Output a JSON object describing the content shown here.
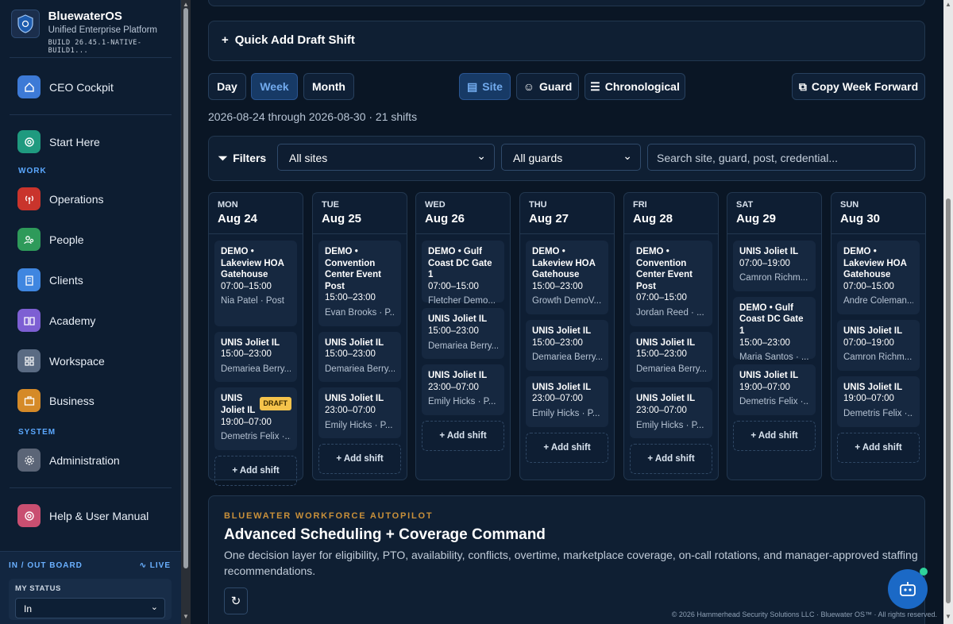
{
  "brand": {
    "title": "BluewaterOS",
    "subtitle": "Unified Enterprise Platform",
    "build": "BUILD 26.45.1-NATIVE-BUILD1..."
  },
  "nav": {
    "ceo": "CEO Cockpit",
    "start": "Start Here",
    "work_header": "WORK",
    "operations": "Operations",
    "people": "People",
    "clients": "Clients",
    "academy": "Academy",
    "workspace": "Workspace",
    "business": "Business",
    "system_header": "SYSTEM",
    "administration": "Administration",
    "help": "Help & User Manual"
  },
  "inout": {
    "header": "IN / OUT BOARD",
    "live": "LIVE",
    "my_status_label": "MY STATUS",
    "status_value": "In"
  },
  "quick_add": "Quick Add Draft Shift",
  "views": {
    "day": "Day",
    "week": "Week",
    "month": "Month",
    "site": "Site",
    "guard": "Guard",
    "chrono": "Chronological",
    "copy": "Copy Week Forward"
  },
  "range": "2026-08-24 through 2026-08-30 · 21 shifts",
  "filters": {
    "label": "Filters",
    "sites": "All sites",
    "guards": "All guards",
    "search_placeholder": "Search site, guard, post, credential..."
  },
  "add_shift": "+ Add shift",
  "draft_badge": "DRAFT",
  "days": [
    {
      "name": "MON",
      "date": "Aug 24",
      "shifts": [
        {
          "title": "DEMO • Lakeview HOA Gatehouse",
          "time": "07:00–15:00",
          "person": "Nia Patel · Post"
        },
        {
          "title": "UNIS Joliet IL",
          "time": "15:00–23:00",
          "person": "Demariea Berry..."
        },
        {
          "title": "UNIS Joliet IL",
          "time": "19:00–07:00",
          "person": "Demetris Felix ·...",
          "draft": true
        }
      ]
    },
    {
      "name": "TUE",
      "date": "Aug 25",
      "shifts": [
        {
          "title": "DEMO • Convention Center Event Post",
          "time": "15:00–23:00",
          "person": "Evan Brooks · P..."
        },
        {
          "title": "UNIS Joliet IL",
          "time": "15:00–23:00",
          "person": "Demariea Berry..."
        },
        {
          "title": "UNIS Joliet IL",
          "time": "23:00–07:00",
          "person": "Emily Hicks · P..."
        }
      ]
    },
    {
      "name": "WED",
      "date": "Aug 26",
      "shifts": [
        {
          "title": "DEMO • Gulf Coast DC Gate 1",
          "time": "07:00–15:00",
          "person": "Fletcher Demo..."
        },
        {
          "title": "UNIS Joliet IL",
          "time": "15:00–23:00",
          "person": "Demariea Berry..."
        },
        {
          "title": "UNIS Joliet IL",
          "time": "23:00–07:00",
          "person": "Emily Hicks · P..."
        }
      ]
    },
    {
      "name": "THU",
      "date": "Aug 27",
      "shifts": [
        {
          "title": "DEMO • Lakeview HOA Gatehouse",
          "time": "15:00–23:00",
          "person": "Growth DemoV..."
        },
        {
          "title": "UNIS Joliet IL",
          "time": "15:00–23:00",
          "person": "Demariea Berry..."
        },
        {
          "title": "UNIS Joliet IL",
          "time": "23:00–07:00",
          "person": "Emily Hicks · P..."
        }
      ]
    },
    {
      "name": "FRI",
      "date": "Aug 28",
      "shifts": [
        {
          "title": "DEMO • Convention Center Event Post",
          "time": "07:00–15:00",
          "person": "Jordan Reed · ..."
        },
        {
          "title": "UNIS Joliet IL",
          "time": "15:00–23:00",
          "person": "Demariea Berry..."
        },
        {
          "title": "UNIS Joliet IL",
          "time": "23:00–07:00",
          "person": "Emily Hicks · P..."
        }
      ]
    },
    {
      "name": "SAT",
      "date": "Aug 29",
      "shifts": [
        {
          "title": "UNIS Joliet IL",
          "time": "07:00–19:00",
          "person": "Camron Richm..."
        },
        {
          "title": "DEMO • Gulf Coast DC Gate 1",
          "time": "15:00–23:00",
          "person": "Maria Santos · ..."
        },
        {
          "title": "UNIS Joliet IL",
          "time": "19:00–07:00",
          "person": "Demetris Felix ·..."
        }
      ]
    },
    {
      "name": "SUN",
      "date": "Aug 30",
      "shifts": [
        {
          "title": "DEMO • Lakeview HOA Gatehouse",
          "time": "07:00–15:00",
          "person": "Andre Coleman..."
        },
        {
          "title": "UNIS Joliet IL",
          "time": "07:00–19:00",
          "person": "Camron Richm..."
        },
        {
          "title": "UNIS Joliet IL",
          "time": "19:00–07:00",
          "person": "Demetris Felix ·..."
        }
      ]
    }
  ],
  "autopilot": {
    "kicker": "BLUEWATER WORKFORCE AUTOPILOT",
    "title": "Advanced Scheduling + Coverage Command",
    "desc": "One decision layer for eligibility, PTO, availability, conflicts, overtime, marketplace coverage, on-call rotations, and manager-approved staffing recommendations."
  },
  "footer": "© 2026 Hammerhead Security Solutions LLC · Bluewater OS™ · All rights reserved.",
  "colors": {
    "accent": "#5ba8ff",
    "draft": "#f5c34b",
    "autopilot_kicker": "#c9903a"
  }
}
